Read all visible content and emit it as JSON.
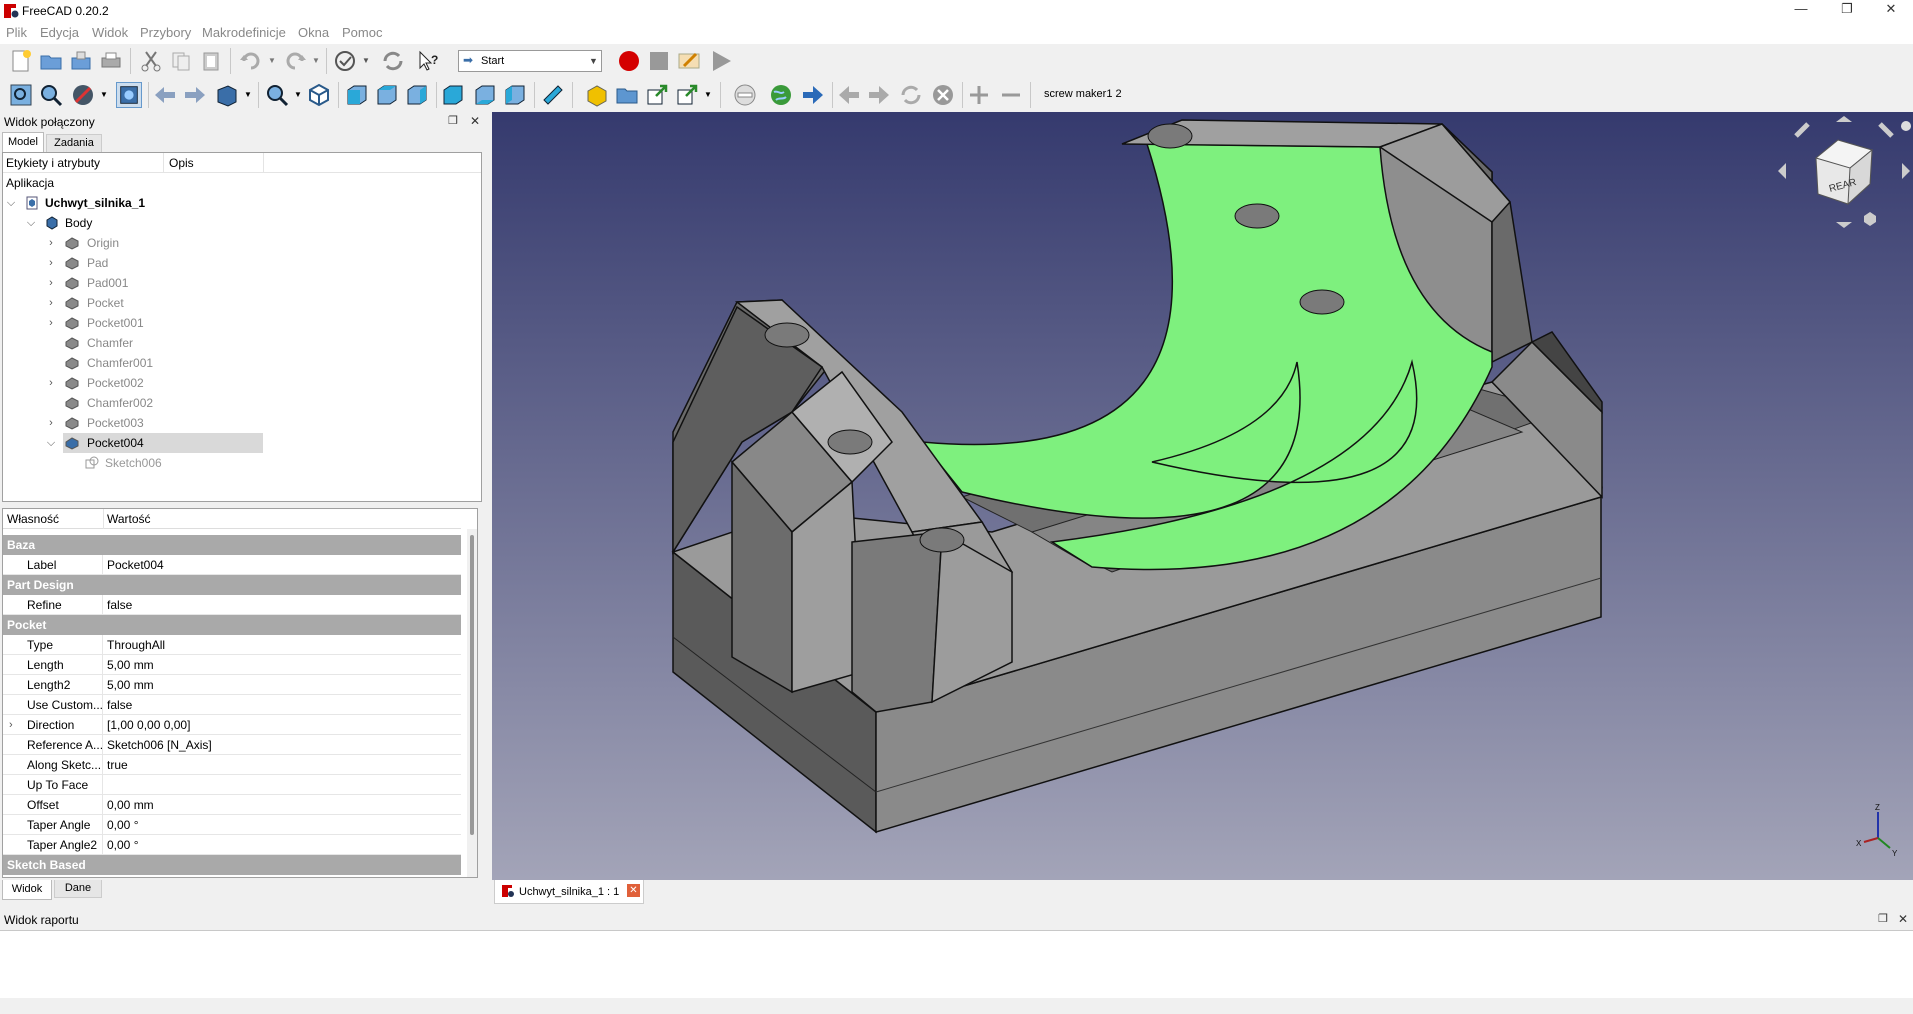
{
  "window": {
    "title": "FreeCAD 0.20.2",
    "minimize": "—",
    "maximize": "❐",
    "close": "✕"
  },
  "menu": [
    "Plik",
    "Edycja",
    "Widok",
    "Przybory",
    "Makrodefinicje",
    "Okna",
    "Pomoc"
  ],
  "toolbar": {
    "workbench": "Start",
    "macro_label": "screw maker1 2"
  },
  "combo": {
    "title": "Widok połączony",
    "tabs": [
      "Model",
      "Zadania"
    ],
    "tree_headers": [
      "Etykiety i atrybuty",
      "Opis"
    ],
    "tree_root": "Aplikacja",
    "document": "Uchwyt_silnika_1",
    "body": "Body",
    "items": [
      {
        "label": "Origin",
        "expandable": true
      },
      {
        "label": "Pad",
        "expandable": true
      },
      {
        "label": "Pad001",
        "expandable": true
      },
      {
        "label": "Pocket",
        "expandable": true
      },
      {
        "label": "Pocket001",
        "expandable": true
      },
      {
        "label": "Chamfer",
        "expandable": false
      },
      {
        "label": "Chamfer001",
        "expandable": false
      },
      {
        "label": "Pocket002",
        "expandable": true
      },
      {
        "label": "Chamfer002",
        "expandable": false
      },
      {
        "label": "Pocket003",
        "expandable": true
      },
      {
        "label": "Pocket004",
        "expandable": true,
        "selected": true
      }
    ],
    "child": "Sketch006"
  },
  "properties": {
    "headers": [
      "Własność",
      "Wartość"
    ],
    "groups": {
      "baza": "Baza",
      "part_design": "Part Design",
      "pocket": "Pocket",
      "sketch_based": "Sketch Based"
    },
    "label": {
      "name": "Label",
      "value": "Pocket004"
    },
    "refine": {
      "name": "Refine",
      "value": "false"
    },
    "pocket_rows": [
      {
        "name": "Type",
        "value": "ThroughAll"
      },
      {
        "name": "Length",
        "value": "5,00 mm"
      },
      {
        "name": "Length2",
        "value": "5,00 mm"
      },
      {
        "name": "Use Custom...",
        "value": "false"
      },
      {
        "name": "Direction",
        "value": "[1,00 0,00 0,00]"
      },
      {
        "name": "Reference A...",
        "value": "Sketch006 [N_Axis]"
      },
      {
        "name": "Along Sketc...",
        "value": "true"
      },
      {
        "name": "Up To Face",
        "value": ""
      },
      {
        "name": "Offset",
        "value": "0,00 mm"
      },
      {
        "name": "Taper Angle",
        "value": "0,00 °"
      },
      {
        "name": "Taper Angle2",
        "value": "0,00 °"
      }
    ],
    "bottom_tabs": [
      "Widok",
      "Dane"
    ]
  },
  "viewport": {
    "nav_cube_face": "REAR",
    "axis_z": "Z",
    "axis_x": "X",
    "axis_y": "Y"
  },
  "doc_tab": "Uchwyt_silnika_1 : 1",
  "report": {
    "title": "Widok raportu"
  },
  "colors": {
    "highlight_face": "#7ef07e",
    "viewport_top": "#353a6e",
    "viewport_bottom": "#a3a4b8"
  }
}
